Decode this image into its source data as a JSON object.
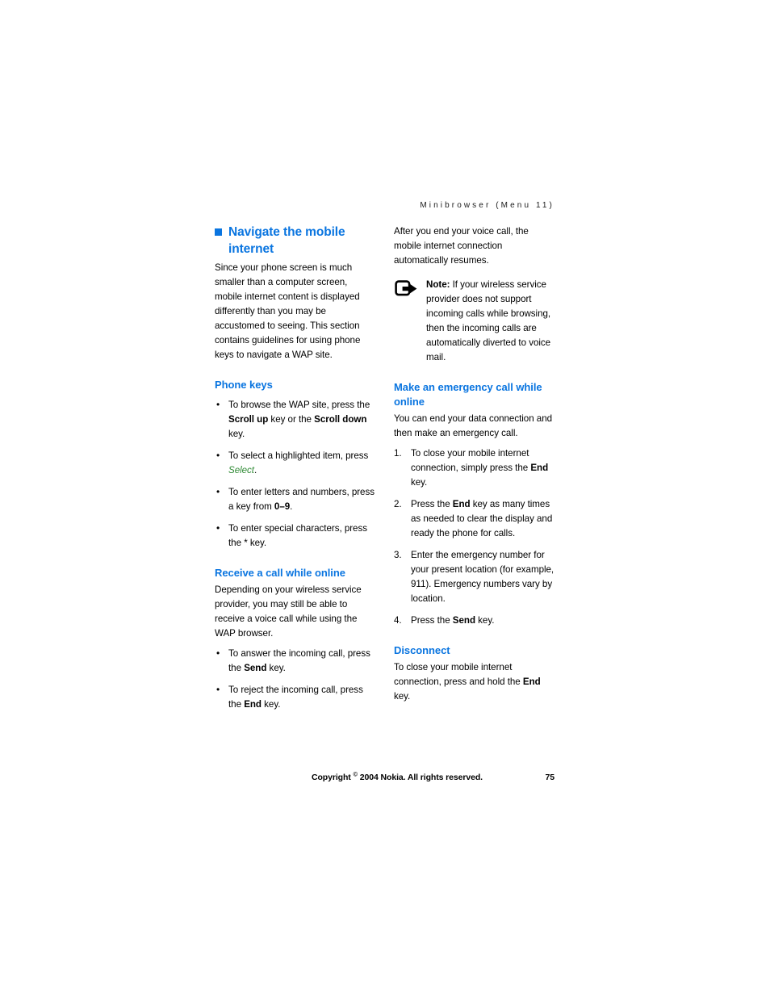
{
  "page": {
    "running_header": "Minibrowser (Menu 11)",
    "page_number": "75",
    "footer_copyright_pre": "Copyright ",
    "footer_copyright_symbol": "©",
    "footer_copyright_post": " 2004 Nokia. All rights reserved.",
    "colors": {
      "heading_blue": "#0a75e0",
      "softkey_green": "#2f8a34",
      "body_black": "#000000",
      "background": "#ffffff"
    }
  },
  "left_column": {
    "h1": "Navigate the mobile internet",
    "intro": "Since your phone screen is much smaller than a computer screen, mobile internet content is displayed differently than you may be accustomed to seeing. This section contains guidelines for using phone keys to navigate a WAP site.",
    "phone_keys": {
      "heading": "Phone keys",
      "items": [
        {
          "seg": [
            {
              "t": "To browse the WAP site, press the ",
              "s": "normal"
            },
            {
              "t": "Scroll up",
              "s": "bold"
            },
            {
              "t": " key or the ",
              "s": "normal"
            },
            {
              "t": "Scroll down",
              "s": "bold"
            },
            {
              "t": " key.",
              "s": "normal"
            }
          ]
        },
        {
          "seg": [
            {
              "t": "To select a highlighted item, press ",
              "s": "normal"
            },
            {
              "t": "Select",
              "s": "green-italic"
            },
            {
              "t": ".",
              "s": "normal"
            }
          ]
        },
        {
          "seg": [
            {
              "t": "To enter letters and numbers, press a key from ",
              "s": "normal"
            },
            {
              "t": "0–9",
              "s": "bold"
            },
            {
              "t": ".",
              "s": "normal"
            }
          ]
        },
        {
          "seg": [
            {
              "t": "To enter special characters, press the ",
              "s": "normal"
            },
            {
              "t": "*",
              "s": "normal"
            },
            {
              "t": " key.",
              "s": "normal"
            }
          ]
        }
      ]
    },
    "receive_call": {
      "heading": "Receive a call while online",
      "intro": "Depending on your wireless service provider, you may still be able to receive a voice call while using the WAP browser.",
      "items": [
        {
          "seg": [
            {
              "t": "To answer the incoming call, press the ",
              "s": "normal"
            },
            {
              "t": "Send",
              "s": "bold"
            },
            {
              "t": " key.",
              "s": "normal"
            }
          ]
        },
        {
          "seg": [
            {
              "t": "To reject the incoming call, press the ",
              "s": "normal"
            },
            {
              "t": "End",
              "s": "bold"
            },
            {
              "t": " key.",
              "s": "normal"
            }
          ]
        }
      ]
    }
  },
  "right_column": {
    "resume_para": "After you end your voice call, the mobile internet connection automatically resumes.",
    "note": {
      "icon_name": "note-arrow-icon",
      "label": "Note:",
      "text": " If your wireless service provider does not support incoming calls while browsing, then the incoming calls are automatically diverted to voice mail."
    },
    "emergency": {
      "heading": "Make an emergency call while online",
      "intro": "You can end your data connection and then make an emergency call.",
      "steps": [
        {
          "seg": [
            {
              "t": "To close your mobile internet connection, simply press the ",
              "s": "normal"
            },
            {
              "t": "End",
              "s": "bold"
            },
            {
              "t": " key.",
              "s": "normal"
            }
          ]
        },
        {
          "seg": [
            {
              "t": "Press the ",
              "s": "normal"
            },
            {
              "t": "End",
              "s": "bold"
            },
            {
              "t": " key as many times as needed to clear the display and ready the phone for calls.",
              "s": "normal"
            }
          ]
        },
        {
          "seg": [
            {
              "t": "Enter the emergency number for your present location (for example, 911). Emergency numbers vary by location.",
              "s": "normal"
            }
          ]
        },
        {
          "seg": [
            {
              "t": "Press the ",
              "s": "normal"
            },
            {
              "t": "Send",
              "s": "bold"
            },
            {
              "t": " key.",
              "s": "normal"
            }
          ]
        }
      ]
    },
    "disconnect": {
      "heading": "Disconnect",
      "seg": [
        {
          "t": "To close your mobile internet connection, press and hold the ",
          "s": "normal"
        },
        {
          "t": "End",
          "s": "bold"
        },
        {
          "t": " key.",
          "s": "normal"
        }
      ]
    }
  }
}
